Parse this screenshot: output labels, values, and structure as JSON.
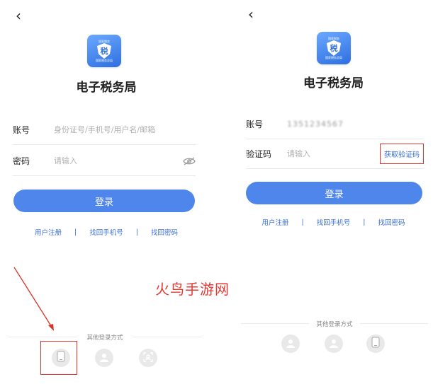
{
  "left": {
    "back_glyph": "‹",
    "app_title": "电子税务局",
    "logo": {
      "top_text": "国家税务",
      "badge": "税",
      "bottom_text": "国家税务总局"
    },
    "account": {
      "label": "账号",
      "placeholder": "身份证号/手机号/用户名/邮箱"
    },
    "password": {
      "label": "密码",
      "placeholder": "请输入"
    },
    "login_label": "登录",
    "links": [
      "用户注册",
      "找回手机号",
      "找回密码"
    ],
    "other_methods": "其他登录方式"
  },
  "right": {
    "back_glyph": "‹",
    "app_title": "电子税务局",
    "logo": {
      "top_text": "国家税务",
      "badge": "税",
      "bottom_text": "国家税务总局"
    },
    "account": {
      "label": "账号",
      "value": "1351234567"
    },
    "code": {
      "label": "验证码",
      "placeholder": "请输入",
      "button": "获取验证码"
    },
    "login_label": "登录",
    "links": [
      "用户注册",
      "找回手机号",
      "找回密码"
    ],
    "other_methods": "其他登录方式"
  },
  "watermark": "火鸟手游网",
  "colors": {
    "primary": "#4f86ec",
    "link": "#3a6fd8",
    "highlight": "#d9342b",
    "watermark": "#e53935"
  },
  "icons": [
    "phone-icon",
    "user-avatar-icon",
    "face-scan-icon"
  ]
}
